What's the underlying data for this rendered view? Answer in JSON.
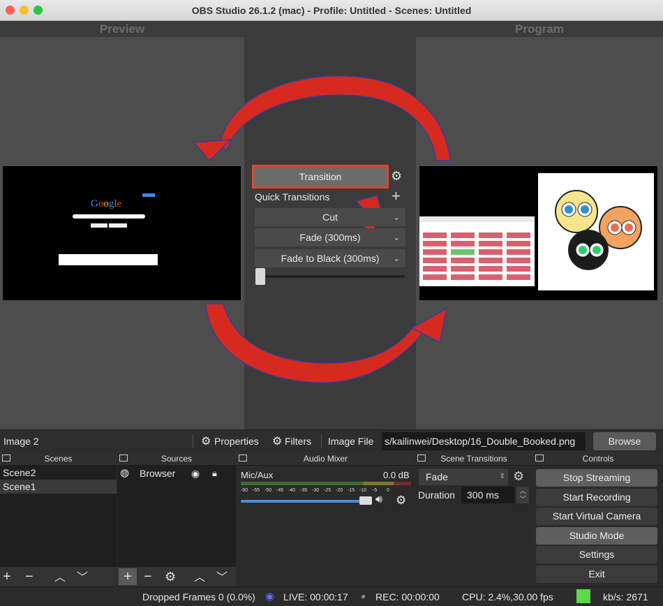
{
  "window": {
    "title": "OBS Studio 26.1.2 (mac) - Profile: Untitled - Scenes: Untitled"
  },
  "preview": {
    "title": "Preview"
  },
  "program": {
    "title": "Program"
  },
  "studio": {
    "transition_label": "Transition",
    "quick_transitions_label": "Quick Transitions",
    "quick": [
      "Cut",
      "Fade (300ms)",
      "Fade to Black (300ms)"
    ]
  },
  "sourcebar": {
    "source_name": "Image 2",
    "properties_label": "Properties",
    "filters_label": "Filters",
    "image_file_label": "Image File",
    "image_path": "s/kailinwei/Desktop/16_Double_Booked.png",
    "browse_label": "Browse"
  },
  "docks": {
    "scenes": {
      "title": "Scenes",
      "items": [
        "Scene2",
        "Scene1"
      ]
    },
    "sources": {
      "title": "Sources",
      "items": [
        {
          "name": "Browser"
        }
      ]
    },
    "mixer": {
      "title": "Audio Mixer",
      "channel": "Mic/Aux",
      "level": "0.0 dB",
      "ticks": [
        "-60",
        "-55",
        "-50",
        "-45",
        "-40",
        "-35",
        "-30",
        "-25",
        "-20",
        "-15",
        "-10",
        "-5",
        "0"
      ]
    },
    "transitions": {
      "title": "Scene Transitions",
      "selected": "Fade",
      "duration_label": "Duration",
      "duration_value": "300 ms"
    },
    "controls": {
      "title": "Controls",
      "buttons": [
        "Stop Streaming",
        "Start Recording",
        "Start Virtual Camera",
        "Studio Mode",
        "Settings",
        "Exit"
      ]
    }
  },
  "status": {
    "dropped": "Dropped Frames 0 (0.0%)",
    "live": "LIVE: 00:00:17",
    "rec": "REC: 00:00:00",
    "cpu": "CPU: 2.4%,30.00 fps",
    "kbs": "kb/s: 2671"
  },
  "colors": {
    "arrow": "#d62a1f",
    "status_green": "#5bd94b",
    "highlight_border": "#e0462b"
  }
}
